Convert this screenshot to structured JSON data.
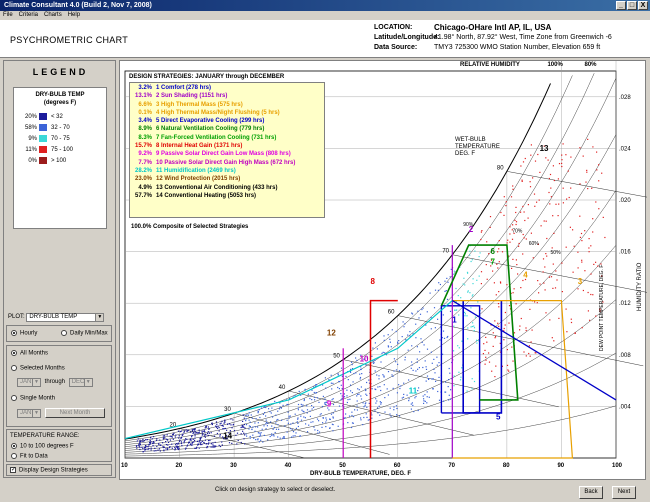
{
  "window": {
    "title": "Climate Consultant 4.0 (Build 2, Nov 7, 2008)",
    "min": "_",
    "max": "□",
    "close": "X"
  },
  "menu": [
    "File",
    "Criteria",
    "Charts",
    "Help"
  ],
  "header": {
    "title": "PSYCHROMETRIC CHART",
    "location_key": "LOCATION:",
    "location": "Chicago-OHare Intl AP, IL, USA",
    "latlon_key": "Latitude/Longitude:",
    "latlon": "41.98° North, 87.92° West, Time Zone from Greenwich -6",
    "source_key": "Data Source:",
    "source": "TMY3    725300 WMO Station Number, Elevation 659 ft"
  },
  "legend": {
    "title": "LEGEND",
    "heading1": "DRY-BULB TEMP",
    "heading2": "(degrees F)",
    "rows": [
      {
        "pct": "20%",
        "label": "< 32",
        "color": "#1c1c9c"
      },
      {
        "pct": "58%",
        "label": "32 - 70",
        "color": "#3c64d8"
      },
      {
        "pct": "9%",
        "label": "70 - 75",
        "color": "#3cd8d8"
      },
      {
        "pct": "11%",
        "label": "75 - 100",
        "color": "#e02020"
      },
      {
        "pct": "0%",
        "label": "> 100",
        "color": "#9c1c1c"
      }
    ]
  },
  "controls": {
    "plot_label": "PLOT:",
    "plot_value": "DRY-BULB TEMP",
    "hourly": "Hourly",
    "daily": "Daily Min/Max",
    "all_months": "All Months",
    "selected_months": "Selected Months",
    "from_month": "JAN",
    "through": "through",
    "to_month": "DEC",
    "single_month": "Single Month",
    "single_value": "JAN",
    "next_month": "Next Month",
    "temp_range_label": "TEMPERATURE RANGE:",
    "range_10_100": "10 to 100 degrees F",
    "fit_data": "Fit to Data",
    "display_strategies": "Display Design Strategies"
  },
  "chart": {
    "strategies_title": "DESIGN STRATEGIES:  JANUARY through DECEMBER",
    "strategies": [
      {
        "pct": "3.2%",
        "label": "1  Comfort (278 hrs)",
        "color": "#0000c8"
      },
      {
        "pct": "13.1%",
        "label": "2  Sun Shading (1151 hrs)",
        "color": "#a000c8"
      },
      {
        "pct": "6.6%",
        "label": "3  High Thermal Mass (575 hrs)",
        "color": "#e8a000"
      },
      {
        "pct": "0.1%",
        "label": "4  High Thermal Mass/Night Flushing (5 hrs)",
        "color": "#e8a000"
      },
      {
        "pct": "3.4%",
        "label": "5  Direct Evaporative Cooling (299 hrs)",
        "color": "#0000c8"
      },
      {
        "pct": "8.9%",
        "label": "6  Natural Ventilation Cooling (779 hrs)",
        "color": "#008000"
      },
      {
        "pct": "8.3%",
        "label": "7  Fan-Forced Ventilation Cooling (731 hrs)",
        "color": "#00a000"
      },
      {
        "pct": "15.7%",
        "label": "8  Internal Heat Gain (1371 hrs)",
        "color": "#e00000"
      },
      {
        "pct": "9.2%",
        "label": "9  Passive Solar Direct Gain Low Mass (808 hrs)",
        "color": "#e000e0"
      },
      {
        "pct": "7.7%",
        "label": "10  Passive Solar Direct Gain High Mass (672 hrs)",
        "color": "#c000c0"
      },
      {
        "pct": "28.2%",
        "label": "11  Humidification (2469 hrs)",
        "color": "#00c8c8"
      },
      {
        "pct": "23.0%",
        "label": "12  Wind Protection (2015 hrs)",
        "color": "#804000"
      },
      {
        "pct": "4.9%",
        "label": "13  Conventional Air Conditioning (433 hrs)",
        "color": "#000000"
      },
      {
        "pct": "57.7%",
        "label": "14  Conventional Heating (5053 hrs)",
        "color": "#000000"
      }
    ],
    "composite": "100.0%  Composite of Selected Strategies",
    "rh_label": "RELATIVE HUMIDITY",
    "rh100": "100%",
    "rh80": "80%",
    "wetbulb": [
      "WET-BULB",
      "TEMPERATURE",
      "DEG. F"
    ],
    "dewpoint": "DEW POINT TEMPERATURE, DEG. F",
    "humidity_ratio": "HUMIDITY RATIO",
    "xlabel": "DRY-BULB TEMPERATURE, DEG. F",
    "xticks": [
      "10",
      "20",
      "30",
      "40",
      "50",
      "60",
      "70",
      "80",
      "90",
      "100"
    ],
    "hr_ticks": [
      ".028",
      ".024",
      ".020",
      ".016",
      ".012",
      ".008",
      ".004"
    ],
    "wb_ticks": [
      "20",
      "30",
      "40",
      "50",
      "60",
      "70",
      "80"
    ],
    "rh_marks": [
      "90%",
      "70%",
      "60%",
      "50%"
    ],
    "zone_nums": [
      "1",
      "2",
      "3",
      "4",
      "5",
      "6",
      "7",
      "8",
      "9",
      "10",
      "11",
      "12",
      "13",
      "14"
    ]
  },
  "status": {
    "hint": "Click on design strategy to select or deselect.",
    "back": "Back",
    "next": "Next"
  }
}
